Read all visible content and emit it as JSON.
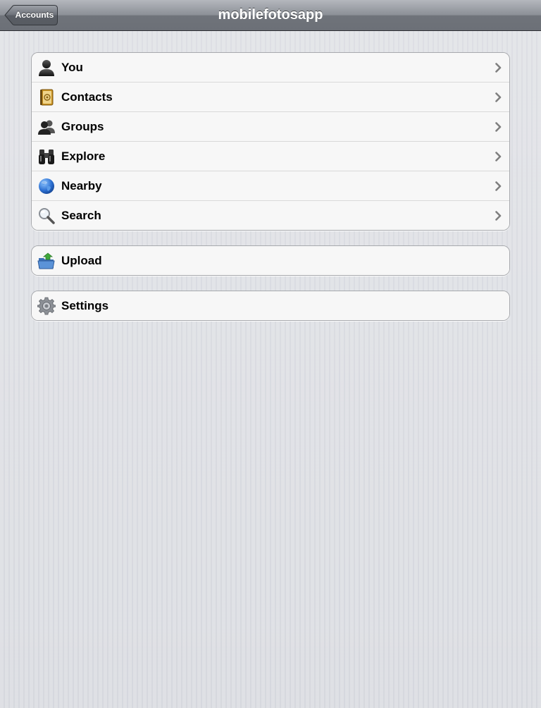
{
  "nav": {
    "title": "mobilefotosapp",
    "back_label": "Accounts"
  },
  "main_menu": {
    "items": [
      {
        "label": "You",
        "icon": "person-icon"
      },
      {
        "label": "Contacts",
        "icon": "address-book-icon"
      },
      {
        "label": "Groups",
        "icon": "group-icon"
      },
      {
        "label": "Explore",
        "icon": "binoculars-icon"
      },
      {
        "label": "Nearby",
        "icon": "globe-icon"
      },
      {
        "label": "Search",
        "icon": "magnifier-icon"
      }
    ]
  },
  "upload_menu": {
    "items": [
      {
        "label": "Upload",
        "icon": "upload-folder-icon"
      }
    ]
  },
  "settings_menu": {
    "items": [
      {
        "label": "Settings",
        "icon": "gear-icon"
      }
    ]
  },
  "colors": {
    "navbar": "#7a7e85",
    "background": "#d6d8de",
    "cell": "#f7f7f7",
    "chevron": "#7f7f7f"
  }
}
